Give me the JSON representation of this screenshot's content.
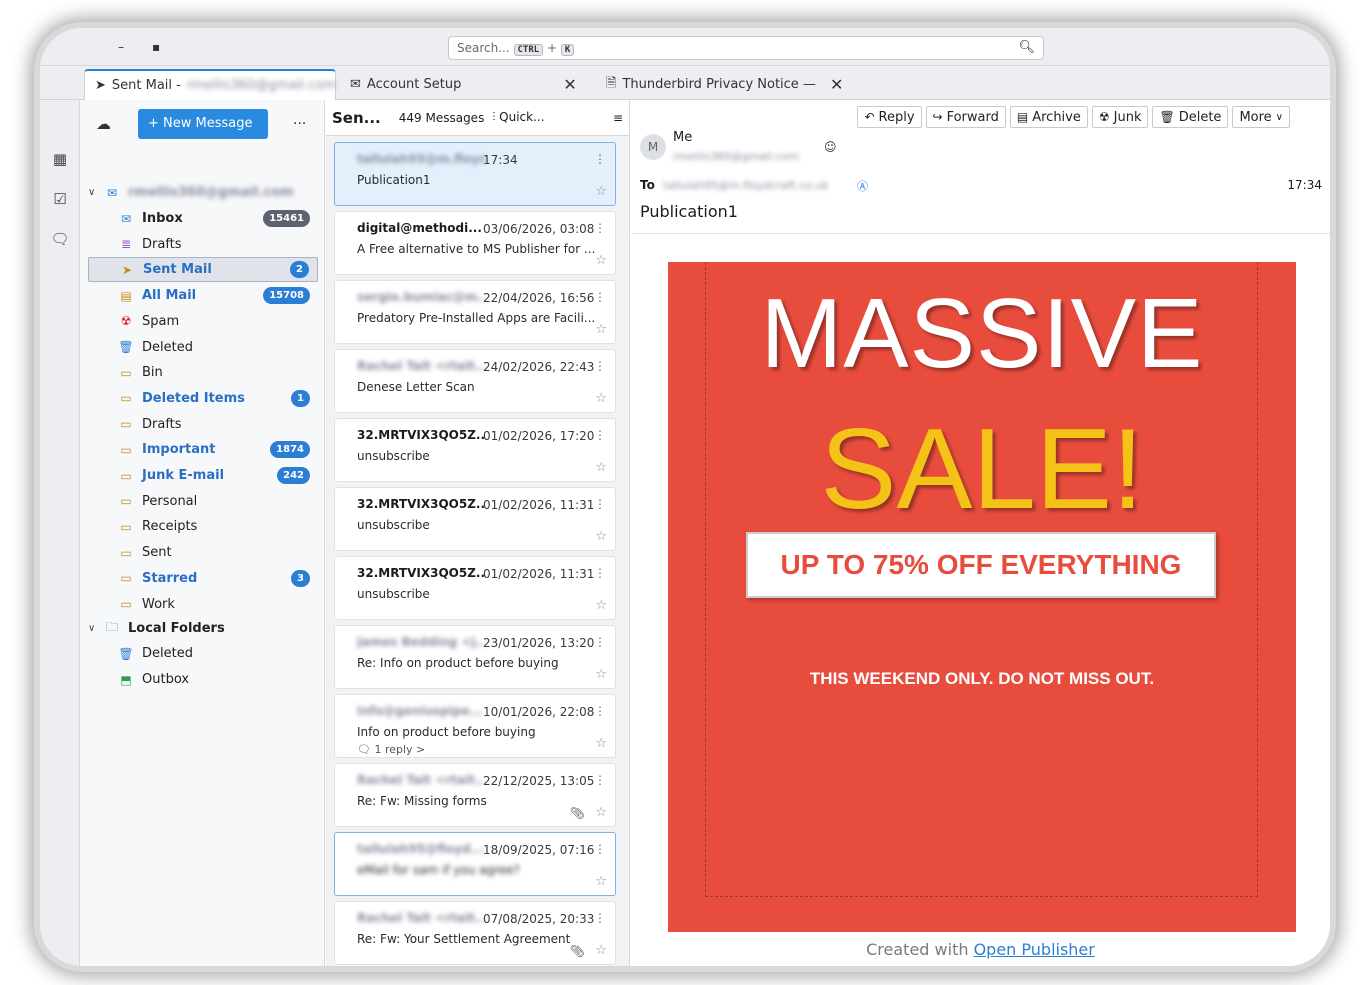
{
  "search": {
    "placeholder": "Search...",
    "kbd1": "CTRL",
    "plus": "+",
    "kbd2": "K"
  },
  "tabs": [
    {
      "label": "Sent Mail -",
      "account": "rmellis360@gmail.com"
    },
    {
      "label": "Account Setup"
    },
    {
      "label": "Thunderbird Privacy Notice —"
    }
  ],
  "folder_pane": {
    "new_message": "+ New Message",
    "menu": "...",
    "account": "rmellis360@gmail.com",
    "folders": [
      {
        "name": "Inbox",
        "badge": "15461",
        "style": "bold",
        "icon": "inbox-icon"
      },
      {
        "name": "Drafts",
        "badge": "",
        "style": "",
        "icon": "drafts-icon"
      },
      {
        "name": "Sent Mail",
        "badge": "2",
        "style": "unread",
        "icon": "sent-icon"
      },
      {
        "name": "All Mail",
        "badge": "15708",
        "style": "unread",
        "icon": "archive-icon"
      },
      {
        "name": "Spam",
        "badge": "",
        "style": "",
        "icon": "spam-icon"
      },
      {
        "name": "Deleted",
        "badge": "",
        "style": "",
        "icon": "trash-icon"
      },
      {
        "name": "Bin",
        "badge": "",
        "style": "",
        "icon": "folder-icon"
      },
      {
        "name": "Deleted Items",
        "badge": "1",
        "style": "unread",
        "icon": "folder-icon"
      },
      {
        "name": "Drafts",
        "badge": "",
        "style": "",
        "icon": "folder-icon"
      },
      {
        "name": "Important",
        "badge": "1874",
        "style": "unread",
        "icon": "folder-icon"
      },
      {
        "name": "Junk E-mail",
        "badge": "242",
        "style": "unread",
        "icon": "folder-icon"
      },
      {
        "name": "Personal",
        "badge": "",
        "style": "",
        "icon": "folder-icon"
      },
      {
        "name": "Receipts",
        "badge": "",
        "style": "",
        "icon": "folder-icon"
      },
      {
        "name": "Sent",
        "badge": "",
        "style": "",
        "icon": "folder-icon"
      },
      {
        "name": "Starred",
        "badge": "3",
        "style": "unread",
        "icon": "folder-icon"
      },
      {
        "name": "Work",
        "badge": "",
        "style": "",
        "icon": "folder-icon"
      }
    ],
    "local_folders": "Local Folders",
    "local": [
      {
        "name": "Deleted",
        "icon": "trash-icon"
      },
      {
        "name": "Outbox",
        "icon": "outbox-icon"
      }
    ]
  },
  "message_list": {
    "title": "Sen...",
    "count": "449 Messages",
    "quick_filter": "Quick...",
    "messages": [
      {
        "from": "tallulah95@m.floydcraft.co.uk",
        "date": "17:34",
        "subject": "Publication1",
        "blurred_from": true,
        "blurred_subject": false,
        "clip": false,
        "reply": ""
      },
      {
        "from": "digital@methodi...",
        "date": "03/06/2026, 03:08",
        "subject": "A Free alternative to MS Publisher for ...",
        "blurred_from": false,
        "blurred_subject": false,
        "clip": false,
        "reply": ""
      },
      {
        "from": "sergio.bumiac@m...",
        "date": "22/04/2026, 16:56",
        "subject": "Predatory Pre-Installed Apps are Facili...",
        "blurred_from": true,
        "blurred_subject": false,
        "clip": false,
        "reply": ""
      },
      {
        "from": "Rachel Tait <rtait...",
        "date": "24/02/2026, 22:43",
        "subject": "Denese Letter Scan",
        "blurred_from": true,
        "blurred_subject": false,
        "clip": false,
        "reply": ""
      },
      {
        "from": "32.MRTVIX3QO5Z...",
        "date": "01/02/2026, 17:20",
        "subject": "unsubscribe",
        "blurred_from": false,
        "blurred_subject": false,
        "clip": false,
        "reply": ""
      },
      {
        "from": "32.MRTVIX3QO5Z...",
        "date": "01/02/2026, 11:31",
        "subject": "unsubscribe",
        "blurred_from": false,
        "blurred_subject": false,
        "clip": false,
        "reply": ""
      },
      {
        "from": "32.MRTVIX3QO5Z...",
        "date": "01/02/2026, 11:31",
        "subject": "unsubscribe",
        "blurred_from": false,
        "blurred_subject": false,
        "clip": false,
        "reply": ""
      },
      {
        "from": "James Bedding <j...",
        "date": "23/01/2026, 13:20",
        "subject": "Re: Info on product before buying",
        "blurred_from": true,
        "blurred_subject": false,
        "clip": false,
        "reply": ""
      },
      {
        "from": "info@geniuspipe...",
        "date": "10/01/2026, 22:08",
        "subject": "Info on product before buying",
        "blurred_from": true,
        "blurred_subject": false,
        "clip": false,
        "reply": "1 reply >"
      },
      {
        "from": "Rachel Tait <rtait...",
        "date": "22/12/2025, 13:05",
        "subject": "Re: Fw: Missing forms",
        "blurred_from": true,
        "blurred_subject": false,
        "clip": true,
        "reply": ""
      },
      {
        "from": "tallulah95@floyd...",
        "date": "18/09/2025, 07:16",
        "subject": "eMail for sam if you agree?",
        "blurred_from": true,
        "blurred_subject": true,
        "clip": false,
        "reply": ""
      },
      {
        "from": "Rachel Tait <rtait...",
        "date": "07/08/2025, 20:33",
        "subject": "Re: Fw: Your Settlement Agreement",
        "blurred_from": true,
        "blurred_subject": false,
        "clip": true,
        "reply": ""
      }
    ]
  },
  "reader": {
    "toolbar": [
      "Reply",
      "Forward",
      "Archive",
      "Junk",
      "Delete",
      "More"
    ],
    "avatar": "M",
    "from_name": "Me",
    "from_address": "rmellis360@gmail.com",
    "to_label": "To",
    "to_address": "tallulah95@m.floydcraft.co.uk",
    "time": "17:34",
    "subject": "Publication1",
    "flyer": {
      "headline": "MASSIVE",
      "sale": "SALE!",
      "offer": "UP TO 75% OFF EVERYTHING",
      "tagline": "THIS WEEKEND ONLY. DO NOT MISS OUT.",
      "background": "#e84c3d",
      "sale_color": "#f5c217"
    },
    "credit_prefix": "Created with",
    "credit_link": "Open Publisher"
  }
}
